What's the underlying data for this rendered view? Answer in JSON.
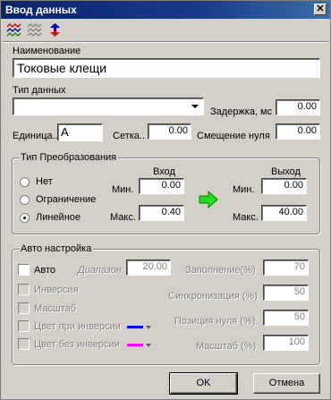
{
  "window": {
    "title": "Ввод данных",
    "close_glyph": "✕"
  },
  "toolbar": {
    "icons": [
      "wave-icon",
      "wave-off-icon",
      "arrows-swap-icon"
    ]
  },
  "name": {
    "label": "Наименование",
    "value": "Токовые клещи"
  },
  "data_type": {
    "label": "Тип данных",
    "value": ""
  },
  "delay": {
    "label": "Задержка, мс",
    "value": "0.00"
  },
  "unit": {
    "label": "Единица..",
    "value": "A"
  },
  "grid": {
    "label": "Сетка..",
    "value": "0.00"
  },
  "zero_offset": {
    "label": "Смещение нуля",
    "value": "0.00"
  },
  "transform": {
    "title": "Тип Преобразования",
    "options": [
      {
        "label": "Нет",
        "selected": false
      },
      {
        "label": "Ограничение",
        "selected": false
      },
      {
        "label": "Линейное",
        "selected": true
      }
    ],
    "input_header": "Вход",
    "output_header": "Выход",
    "min_label": "Мин.",
    "max_label": "Макс.",
    "input_min": "0.00",
    "input_max": "0.40",
    "output_min": "0.00",
    "output_max": "40.00"
  },
  "auto": {
    "title": "Авто настройка",
    "auto_label": "Авто",
    "inversion_label": "Инверсия",
    "scale_label": "Масштаб",
    "color_inv_label": "Цвет при инверсии",
    "color_noinv_label": "Цвет без инверсии",
    "color_inv": "#0000ff",
    "color_noinv": "#ff00ff",
    "range_label": "Диапазон.",
    "range_value": "20.00",
    "fill_label": "Заполнение(%)",
    "fill_value": "70",
    "sync_label": "Синхронизация (%)",
    "sync_value": "50",
    "zero_pos_label": "Позиция нуля (%)",
    "zero_pos_value": "50",
    "scale_pct_label": "Масштаб (%)",
    "scale_pct_value": "100"
  },
  "buttons": {
    "ok": "OK",
    "cancel": "Отмена"
  }
}
